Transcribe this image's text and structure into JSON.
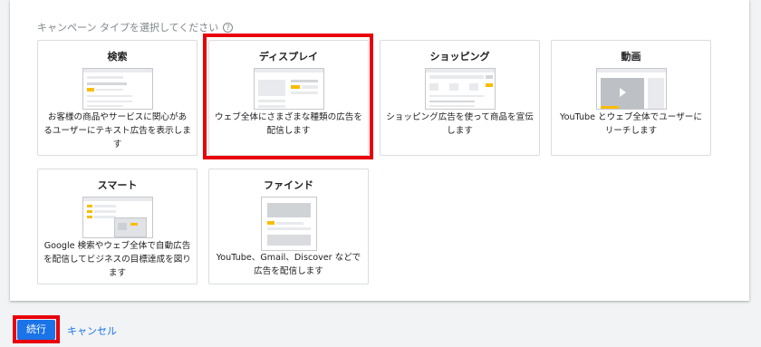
{
  "heading": "キャンペーン タイプを選択してください",
  "help_icon": "question-circle-icon",
  "cards": [
    {
      "title": "検索",
      "description": "お客様の商品やサービスに関心があるユーザーにテキスト広告を表示します"
    },
    {
      "title": "ディスプレイ",
      "description": "ウェブ全体にさまざまな種類の広告を配信します"
    },
    {
      "title": "ショッピング",
      "description": "ショッピング広告を使って商品を宣伝します"
    },
    {
      "title": "動画",
      "description": "YouTube とウェブ全体でユーザーにリーチします"
    },
    {
      "title": "スマート",
      "description": "Google 検索やウェブ全体で自動広告を配信してビジネスの目標達成を図ります"
    },
    {
      "title": "ファインド",
      "description": "YouTube、Gmail、Discover などで広告を配信します"
    }
  ],
  "selected_card": "ディスプレイ",
  "actions": {
    "continue_label": "続行",
    "cancel_label": "キャンセル"
  },
  "colors": {
    "accent": "#1a73e8",
    "highlight": "#e8000b",
    "ad_yellow": "#fbbc04"
  }
}
